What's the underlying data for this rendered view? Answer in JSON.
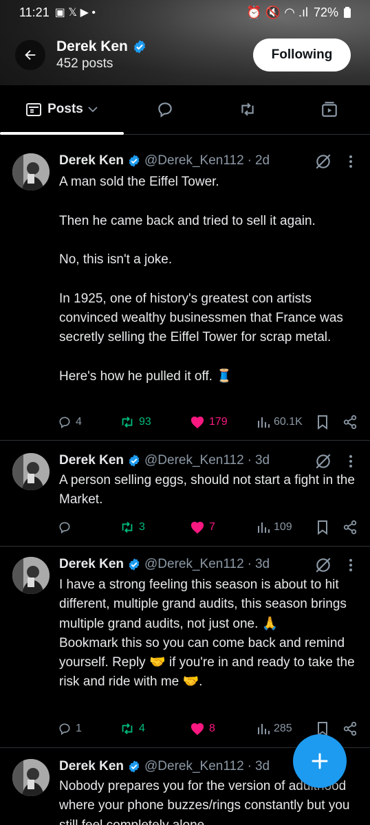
{
  "status": {
    "time": "11:21",
    "battery": "72%",
    "left_icons": "▣ 𝕏 ▶ •",
    "right_icons": "⏰ 🔇 ◠ .ıl"
  },
  "profile": {
    "name": "Derek Ken",
    "posts": "452 posts",
    "follow_label": "Following"
  },
  "tabs": {
    "posts_label": "Posts"
  },
  "colors": {
    "accent": "#1d9bf0",
    "repost": "#00ba7c",
    "like": "#f91880",
    "muted": "#8b98a5"
  },
  "posts": [
    {
      "name": "Derek Ken",
      "handle": "@Derek_Ken112",
      "time": "2d",
      "text": "A man sold the Eiffel Tower.\n\nThen he came back and tried to sell it again.\n\nNo, this isn't a joke.\n\nIn 1925, one of history's greatest con artists convinced wealthy businessmen that France was secretly selling the Eiffel Tower for scrap metal.\n\nHere's how he pulled it off. 🧵",
      "replies": "4",
      "reposts": "93",
      "likes": "179",
      "views": "60.1K"
    },
    {
      "name": "Derek Ken",
      "handle": "@Derek_Ken112",
      "time": "3d",
      "text": "A person selling eggs, should not start a fight in the Market.",
      "replies": "",
      "reposts": "3",
      "likes": "7",
      "views": "109"
    },
    {
      "name": "Derek Ken",
      "handle": "@Derek_Ken112",
      "time": "3d",
      "text": "I have a strong feeling this season is about to hit different, multiple grand audits, this season brings multiple grand audits, not just one. 🙏\nBookmark this so you can come back and remind yourself. Reply 🤝 if you're in and ready to take the risk and ride with me 🤝.",
      "replies": "1",
      "reposts": "4",
      "likes": "8",
      "views": "285"
    },
    {
      "name": "Derek Ken",
      "handle": "@Derek_Ken112",
      "time": "3d",
      "text": "Nobody prepares you for the version of adulthood where your phone buzzes/rings constantly but you still feel completely alone",
      "replies": "",
      "reposts": "",
      "likes": "",
      "views": ""
    }
  ],
  "icons": {
    "back": "arrow-left-icon",
    "verified": "verified-badge-icon",
    "grok": "grok-icon",
    "more": "more-vertical-icon",
    "reply": "reply-icon",
    "repost": "repost-icon",
    "like": "heart-icon",
    "views": "views-icon",
    "bookmark": "bookmark-icon",
    "share": "share-icon",
    "compose": "plus-icon"
  }
}
